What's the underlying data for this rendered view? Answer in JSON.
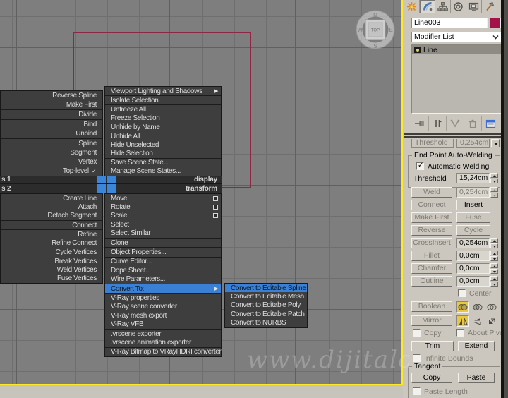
{
  "viewport": {
    "watermark": "www.dijitalde",
    "viewcube": {
      "label": "TOP",
      "n": "N",
      "e": "E",
      "s": "S",
      "w": "W"
    },
    "colors": {
      "background": "#7e7e7e",
      "grid_line": "#6f6f6f",
      "shape_outline": "#8d2746",
      "active_border": "#ffe925"
    }
  },
  "quad_menu": {
    "accent": "#3a80d4",
    "titles": {
      "tools1": "s 1",
      "tools2": "s 2",
      "display": "display",
      "transform": "transform"
    },
    "tools1_groups": [
      [
        "Reverse Spline",
        "Make First"
      ],
      [
        "Divide"
      ],
      [
        "Bind",
        "Unbind"
      ],
      [
        "Spline",
        "Segment",
        "Vertex",
        {
          "label": "Top-level",
          "check": true
        }
      ]
    ],
    "tools2_groups": [
      [
        "Create Line",
        "Attach",
        "Detach Segment"
      ],
      [
        "Connect"
      ],
      [
        "Refine",
        "Refine Connect"
      ],
      [
        "Cycle Vertices",
        "Break Vertices",
        "Weld Vertices",
        "Fuse Vertices"
      ]
    ],
    "display_groups": [
      [
        {
          "label": "Viewport Lighting and Shadows",
          "arrow": true
        }
      ],
      [
        "Isolate Selection"
      ],
      [
        "Unfreeze All",
        "Freeze Selection"
      ],
      [
        "Unhide by Name",
        "Unhide All",
        "Hide Unselected",
        "Hide Selection"
      ],
      [
        "Save Scene State...",
        "Manage Scene States..."
      ]
    ],
    "transform_groups": [
      [
        {
          "label": "Move",
          "settings": true
        },
        {
          "label": "Rotate",
          "settings": true
        },
        {
          "label": "Scale",
          "settings": true
        },
        "Select",
        "Select Similar"
      ],
      [
        "Clone"
      ],
      [
        "Object Properties..."
      ],
      [
        "Curve Editor...",
        "Dope Sheet...",
        "Wire Parameters..."
      ],
      [
        {
          "label": "Convert To:",
          "arrow": true,
          "hl": true
        }
      ],
      [
        "V-Ray properties",
        "V-Ray scene converter",
        "V-Ray mesh export",
        "V-Ray VFB"
      ],
      [
        ".vrscene exporter",
        ".vrscene animation exporter"
      ],
      [
        "V-Ray Bitmap to VRayHDRI converter"
      ]
    ],
    "convert_submenu": [
      {
        "label": "Convert to Editable Spline",
        "hl": true
      },
      "Convert to Editable Mesh",
      "Convert to Editable Poly",
      "Convert to Editable Patch",
      "Convert to NURBS"
    ]
  },
  "command_panel": {
    "tabs": [
      "create",
      "modify",
      "hierarchy",
      "motion",
      "display",
      "utilities"
    ],
    "active_tab": "modify",
    "object_name": "Line003",
    "object_color": "#a2134a",
    "modifier_list": "Modifier List",
    "stack_item": "Line",
    "stack_tools": [
      "pin-stack",
      "show-end-result",
      "make-unique",
      "remove-modifier",
      "configure-modifier-sets"
    ],
    "clipped": {
      "label": "Threshold",
      "value": "0,254cm"
    },
    "autoweld": {
      "title": "End Point Auto-Welding",
      "checkbox": "Automatic Welding",
      "checked": true,
      "threshold_label": "Threshold",
      "threshold_value": "15,24cm"
    },
    "weld": "Weld",
    "weld_value": "0,254cm",
    "connect": "Connect",
    "insert": "Insert",
    "make_first": "Make First",
    "fuse": "Fuse",
    "reverse": "Reverse",
    "cycle": "Cycle",
    "crossinsert": "CrossInsert",
    "crossinsert_value": "0,254cm",
    "fillet": "Fillet",
    "fillet_value": "0,0cm",
    "chamfer": "Chamfer",
    "chamfer_value": "0,0cm",
    "outline": "Outline",
    "outline_value": "0,0cm",
    "center": "Center",
    "boolean": "Boolean",
    "boolean_icons": [
      "boolean-union-icon",
      "boolean-subtract-icon",
      "boolean-intersect-icon"
    ],
    "mirror": "Mirror",
    "mirror_icons": [
      "mirror-horizontal-icon",
      "mirror-vertical-icon",
      "mirror-both-icon"
    ],
    "copy": "Copy",
    "about_pivot": "About Pivot",
    "trim": "Trim",
    "extend": "Extend",
    "infinite_bounds": "Infinite Bounds",
    "tangent": {
      "title": "Tangent",
      "copy": "Copy",
      "paste": "Paste",
      "paste_length": "Paste Length"
    },
    "highlight_yellow": "#e9c83e"
  }
}
